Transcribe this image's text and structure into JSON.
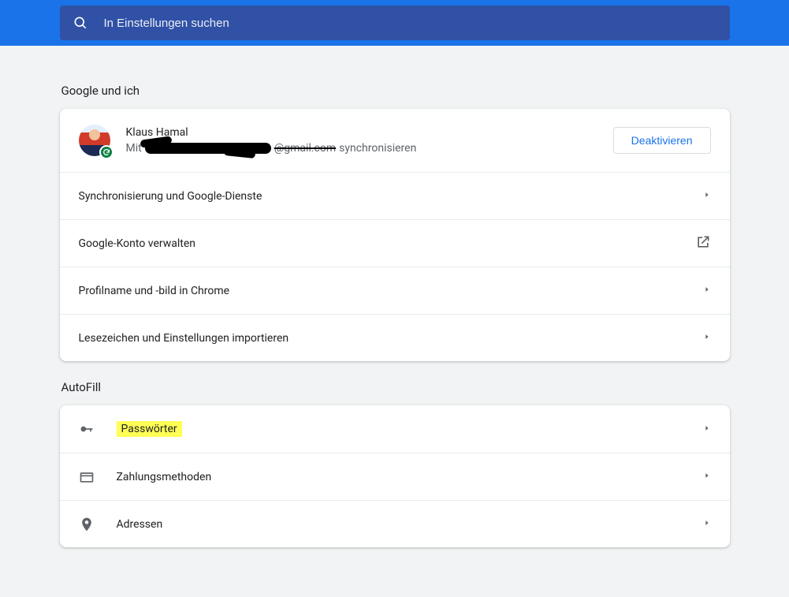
{
  "search": {
    "placeholder": "In Einstellungen suchen"
  },
  "sections": {
    "google": {
      "title": "Google und ich",
      "profile": {
        "name": "Klaus Hamal",
        "sub_prefix": "Mit",
        "email_visible_part": "@gmail.com",
        "sub_suffix": "synchronisieren",
        "deactivate_label": "Deaktivieren"
      },
      "rows": {
        "sync": "Synchronisierung und Google-Dienste",
        "manage": "Google-Konto verwalten",
        "profile": "Profilname und -bild in Chrome",
        "import": "Lesezeichen und Einstellungen importieren"
      }
    },
    "autofill": {
      "title": "AutoFill",
      "rows": {
        "passwords": "Passwörter",
        "payments": "Zahlungsmethoden",
        "addresses": "Adressen"
      }
    }
  }
}
